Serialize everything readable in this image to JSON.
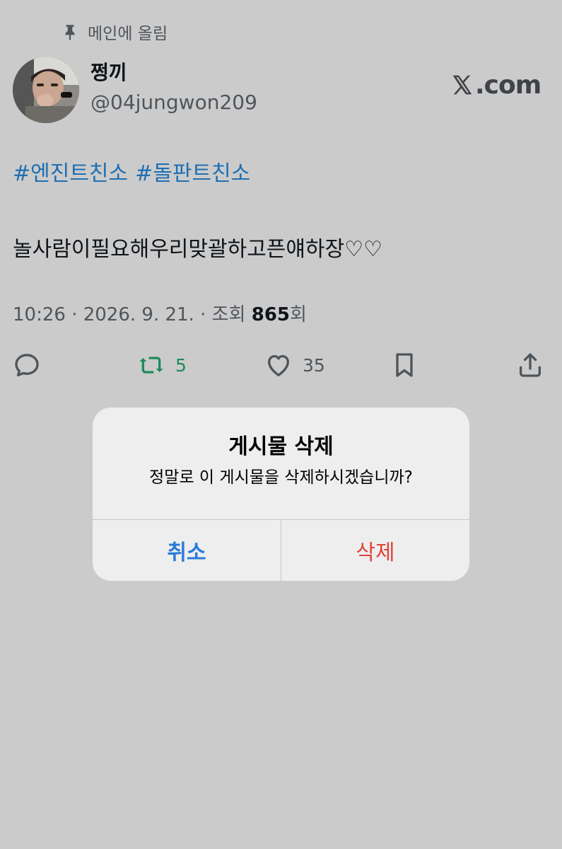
{
  "pinned": {
    "label": "메인에 올림",
    "icon": "pin-icon"
  },
  "author": {
    "name": "쩡끼",
    "handle": "@04jungwon209"
  },
  "brand": {
    "logo_text": ".com",
    "icon": "x-logo-icon"
  },
  "post": {
    "hashtags": [
      "#엔진트친소",
      "#돌판트친소"
    ],
    "text": "놀사람이필요해우리맞괄하고픈얘하장♡♡",
    "time": "10:26 · 2026. 9. 21. · 조회 ",
    "views": "865",
    "views_suffix": "회"
  },
  "actions": {
    "reply": {
      "icon": "reply-icon",
      "count": ""
    },
    "retweet": {
      "icon": "retweet-icon",
      "count": "5",
      "color": "#1e8a5a"
    },
    "like": {
      "icon": "heart-icon",
      "count": "35"
    },
    "bookmark": {
      "icon": "bookmark-icon"
    },
    "share": {
      "icon": "share-icon"
    }
  },
  "dialog": {
    "title": "게시물 삭제",
    "message": "정말로 이 게시물을 삭제하시겠습니까?",
    "cancel": "취소",
    "delete": "삭제",
    "cancel_color": "#2a7bd8",
    "delete_color": "#e0443a"
  },
  "colors": {
    "background": "#cbcbcb",
    "hashtag": "#1f6fb2"
  }
}
